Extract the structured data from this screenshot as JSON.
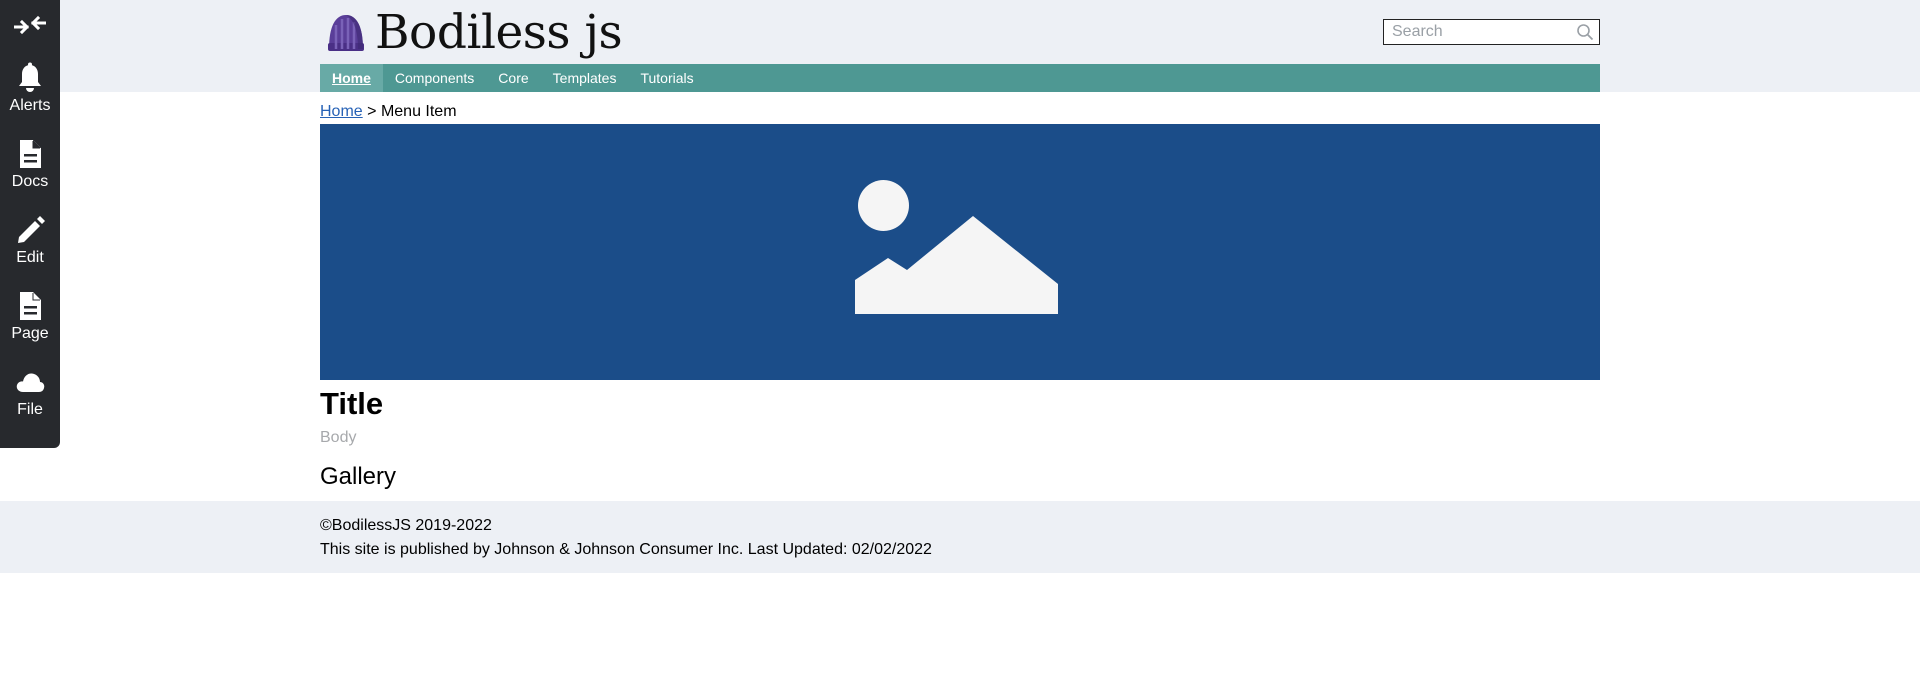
{
  "header": {
    "logo_text": "Bodiless js",
    "search_placeholder": "Search"
  },
  "nav": {
    "items": [
      {
        "label": "Home",
        "active": true
      },
      {
        "label": "Components"
      },
      {
        "label": "Core"
      },
      {
        "label": "Templates"
      },
      {
        "label": "Tutorials"
      }
    ]
  },
  "toolbar": {
    "items": [
      {
        "label": "Alerts",
        "icon": "bell-icon"
      },
      {
        "label": "Docs",
        "icon": "document-icon"
      },
      {
        "label": "Edit",
        "icon": "pencil-icon"
      },
      {
        "label": "Page",
        "icon": "page-icon"
      },
      {
        "label": "File",
        "icon": "cloud-icon"
      }
    ],
    "collapse_icon": "collapse-arrows-icon"
  },
  "breadcrumb": {
    "home": "Home",
    "separator": ">",
    "current": "Menu Item"
  },
  "content": {
    "hero_icon": "image-placeholder-icon",
    "title": "Title",
    "body": "Body",
    "gallery": "Gallery"
  },
  "footer": {
    "copyright": "©BodilessJS 2019-2022",
    "published": "This site is published by Johnson & Johnson Consumer Inc. Last Updated: 02/02/2022"
  },
  "colors": {
    "header_bg": "#edf0f5",
    "nav_bg": "#4e9893",
    "nav_active_bg": "#68aaa6",
    "toolbar_bg": "#27292d",
    "hero_bg": "#1b4d89",
    "link": "#2762b6"
  }
}
